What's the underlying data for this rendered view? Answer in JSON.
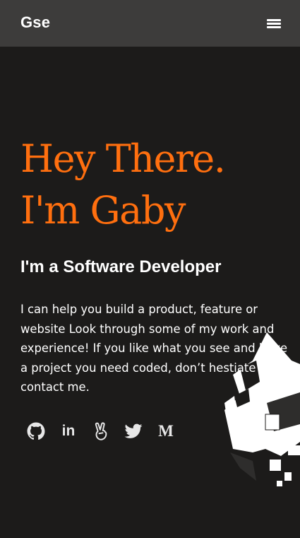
{
  "navbar": {
    "brand": "Gse",
    "menu_icon": "hamburger-menu-icon"
  },
  "hero": {
    "title_lines": [
      "Hey There.",
      "I'm Gaby"
    ],
    "subtitle": "I'm a Software Developer",
    "intro": "I can help you build a product, feature or website Look through some of my work and experience! If you like what you see and have a project you need coded, don’t hestiate to contact me."
  },
  "socials": [
    {
      "icon": "github-icon"
    },
    {
      "icon": "linkedin-icon",
      "label": "in"
    },
    {
      "icon": "peace-hand-icon"
    },
    {
      "icon": "twitter-icon"
    },
    {
      "icon": "medium-icon",
      "label": "M"
    }
  ],
  "colors": {
    "background": "#1c1b1a",
    "navbar": "#3d3c3b",
    "accent": "#ff6f0f",
    "text": "#ffffff",
    "icon": "#e7e7e7"
  }
}
